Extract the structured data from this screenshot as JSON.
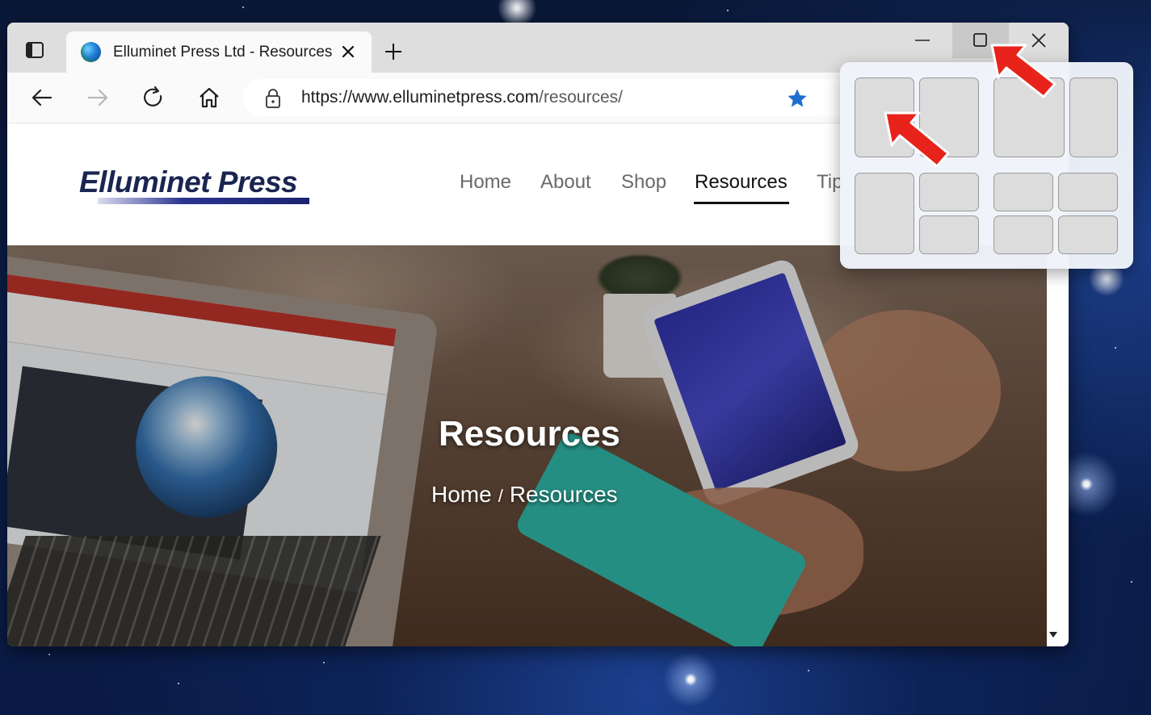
{
  "browser": {
    "tab_title": "Elluminet Press Ltd - Resources",
    "url_domain": "https://www.elluminetpress.com",
    "url_path": "/resources/",
    "icons": {
      "tab_actions": "tab-actions-icon",
      "favicon": "globe-favicon-icon",
      "close_tab": "close-icon",
      "new_tab": "plus-icon",
      "minimize": "minimize-icon",
      "maximize": "maximize-icon",
      "close_window": "close-icon",
      "back": "back-arrow-icon",
      "forward": "forward-arrow-icon",
      "refresh": "refresh-icon",
      "home": "home-icon",
      "lock": "lock-icon",
      "favorite": "star-icon"
    },
    "accent_color": "#1f6fd1"
  },
  "site": {
    "logo": "Elluminet Press",
    "nav": [
      "Home",
      "About",
      "Shop",
      "Resources",
      "Tip"
    ],
    "active_nav": "Resources",
    "hero": {
      "title": "Resources",
      "breadcrumb_home": "Home",
      "breadcrumb_sep": "/",
      "breadcrumb_current": "Resources"
    },
    "logo_color": "#1a2550"
  },
  "snap_layouts": {
    "layouts": [
      {
        "name": "two-column-equal",
        "zones": 2
      },
      {
        "name": "two-column-wide-left",
        "zones": 2
      },
      {
        "name": "three-zone-left-tall",
        "zones": 3
      },
      {
        "name": "four-quadrant",
        "zones": 4
      }
    ]
  },
  "annotations": {
    "arrow_color": "#e8231c"
  }
}
